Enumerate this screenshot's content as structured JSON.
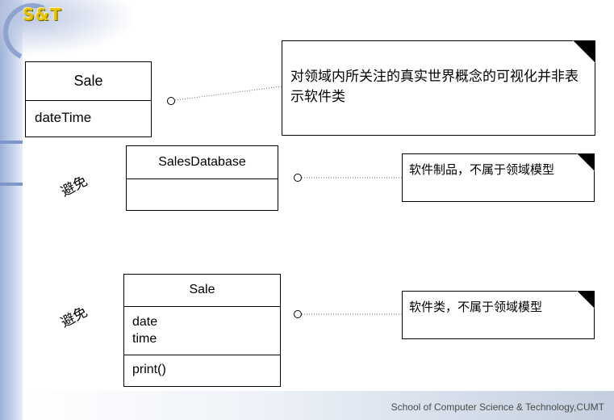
{
  "logo": {
    "text": "S&T"
  },
  "footer": {
    "text": "School of Computer Science & Technology,CUMT"
  },
  "example1": {
    "class_name": "Sale",
    "attributes": [
      "dateTime"
    ],
    "note": "对领域内所关注的真实世界概念的可视化并非表示软件类"
  },
  "example2": {
    "label": "避免",
    "class_name": "SalesDatabase",
    "note": "软件制品，不属于领域模型"
  },
  "example3": {
    "label": "避免",
    "class_name": "Sale",
    "attributes": [
      "date",
      "time"
    ],
    "operations": [
      "print()"
    ],
    "note": "软件类，不属于领域模型"
  },
  "colors": {
    "accent": "#8fa3cf",
    "logo": "#e7c400"
  }
}
